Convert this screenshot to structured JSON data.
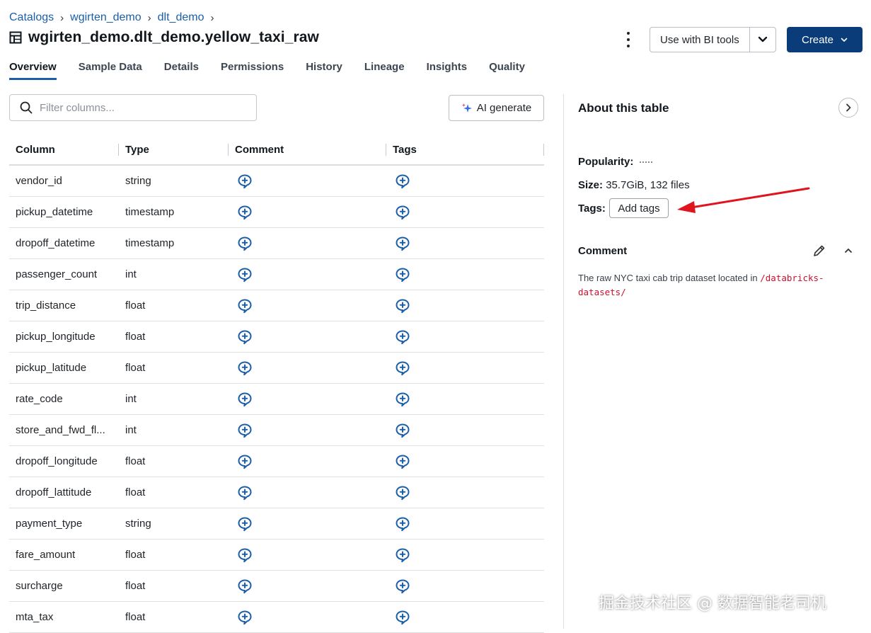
{
  "breadcrumb": [
    {
      "label": "Catalogs"
    },
    {
      "label": "wgirten_demo"
    },
    {
      "label": "dlt_demo"
    }
  ],
  "breadcrumb_separator": "›",
  "page_title": "wgirten_demo.dlt_demo.yellow_taxi_raw",
  "header_actions": {
    "bi_tools_label": "Use with BI tools",
    "create_label": "Create"
  },
  "tabs": [
    {
      "label": "Overview",
      "active": true
    },
    {
      "label": "Sample Data"
    },
    {
      "label": "Details"
    },
    {
      "label": "Permissions"
    },
    {
      "label": "History"
    },
    {
      "label": "Lineage"
    },
    {
      "label": "Insights"
    },
    {
      "label": "Quality"
    }
  ],
  "filter": {
    "placeholder": "Filter columns..."
  },
  "ai_generate_label": "AI generate",
  "columns_table": {
    "headers": [
      "Column",
      "Type",
      "Comment",
      "Tags"
    ],
    "rows": [
      {
        "name": "vendor_id",
        "type": "string"
      },
      {
        "name": "pickup_datetime",
        "type": "timestamp"
      },
      {
        "name": "dropoff_datetime",
        "type": "timestamp"
      },
      {
        "name": "passenger_count",
        "type": "int"
      },
      {
        "name": "trip_distance",
        "type": "float"
      },
      {
        "name": "pickup_longitude",
        "type": "float"
      },
      {
        "name": "pickup_latitude",
        "type": "float"
      },
      {
        "name": "rate_code",
        "type": "int"
      },
      {
        "name": "store_and_fwd_fl...",
        "type": "int"
      },
      {
        "name": "dropoff_longitude",
        "type": "float"
      },
      {
        "name": "dropoff_lattitude",
        "type": "float"
      },
      {
        "name": "payment_type",
        "type": "string"
      },
      {
        "name": "fare_amount",
        "type": "float"
      },
      {
        "name": "surcharge",
        "type": "float"
      },
      {
        "name": "mta_tax",
        "type": "float"
      }
    ]
  },
  "about": {
    "title": "About this table",
    "popularity_label": "Popularity:",
    "size_label": "Size:",
    "size_value": "35.7GiB, 132 files",
    "tags_label": "Tags:",
    "add_tags_label": "Add tags",
    "comment_title": "Comment",
    "comment_text": "The raw NYC taxi cab trip dataset located in",
    "comment_path": "/databricks-datasets/"
  },
  "watermark": "掘金技术社区 @ 数据智能老司机",
  "colors": {
    "link": "#1a5fa8",
    "primary_button": "#0b3c7a",
    "icon_blue": "#1a5fa8",
    "code_red": "#c8102e",
    "annotation_arrow": "#e0141e"
  }
}
